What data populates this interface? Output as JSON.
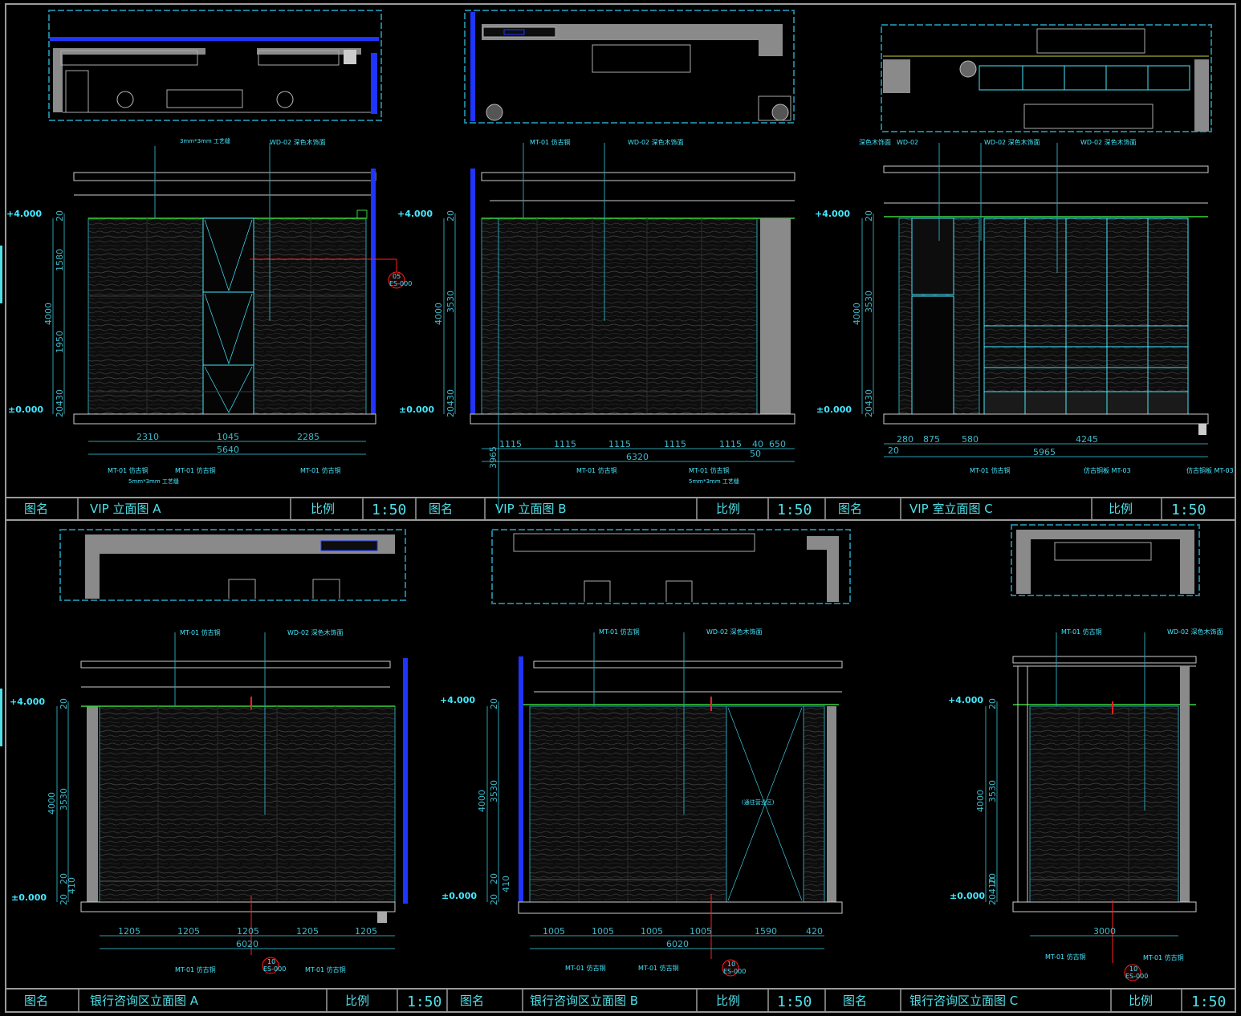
{
  "title_block": {
    "row1": [
      {
        "name_label": "图名",
        "name": "VIP 立面图  A",
        "scale_label": "比例",
        "scale": "1:50"
      },
      {
        "name_label": "图名",
        "name": "VIP 立面图  B",
        "scale_label": "比例",
        "scale": "1:50"
      },
      {
        "name_label": "图名",
        "name": "VIP 室立面图  C",
        "scale_label": "比例",
        "scale": "1:50"
      }
    ],
    "row2": [
      {
        "name_label": "图名",
        "name": "银行咨询区立面图  A",
        "scale_label": "比例",
        "scale": "1:50"
      },
      {
        "name_label": "图名",
        "name": "银行咨询区立面图    B",
        "scale_label": "比例",
        "scale": "1:50"
      },
      {
        "name_label": "图名",
        "name": "银行咨询区立面图    C",
        "scale_label": "比例",
        "scale": "1:50"
      }
    ]
  },
  "levels": {
    "top": "+4.000",
    "bottom": "±0.000"
  },
  "drawings": [
    {
      "id": "vip-a",
      "tags": [
        "3mm*3mm 工艺缝",
        "WD-02  深色木饰面",
        "MT-01  仿古铜",
        "MT-01  仿古铜",
        "MT-01  仿古铜",
        "5mm*3mm 工艺缝"
      ],
      "callout": [
        "05",
        "ES-000"
      ],
      "vdims": [
        "20",
        "1580",
        "4000",
        "1950",
        "20",
        "430"
      ],
      "hdims": [
        "2310",
        "1045",
        "2285"
      ],
      "total": "5640"
    },
    {
      "id": "vip-b",
      "tags": [
        "MT-01  仿古铜",
        "WD-02  深色木饰面",
        "MT-01  仿古铜",
        "MT-01  仿古铜",
        "5mm*3mm 工艺缝"
      ],
      "vdims": [
        "20",
        "3530",
        "4000",
        "20",
        "430"
      ],
      "hdims": [
        "1115",
        "1115",
        "1115",
        "1115",
        "1115",
        "40",
        "650"
      ],
      "total": "6320",
      "extra": [
        "50",
        "3965"
      ]
    },
    {
      "id": "vip-c",
      "tags": [
        "深色木饰面",
        "WD-02",
        "WD-02  深色木饰面",
        "WD-02  深色木饰面",
        "MT-01  仿古铜",
        "仿古铜板  MT-03",
        "仿古铜板  MT-03"
      ],
      "vdims": [
        "20",
        "3530",
        "4000",
        "20",
        "430"
      ],
      "hdims": [
        "280",
        "875",
        "580",
        "4245"
      ],
      "total": "5965",
      "extra": [
        "20"
      ]
    },
    {
      "id": "bank-a",
      "tags": [
        "MT-01  仿古铜",
        "WD-02  深色木饰面",
        "MT-01  仿古铜",
        "MT-01  仿古铜"
      ],
      "callout": [
        "10",
        "ES-000"
      ],
      "vdims": [
        "20",
        "3530",
        "4000",
        "20",
        "410",
        "20"
      ],
      "hdims": [
        "1205",
        "1205",
        "1205",
        "1205",
        "1205"
      ],
      "total": "6020"
    },
    {
      "id": "bank-b",
      "tags": [
        "MT-01  仿古铜",
        "WD-02  深色木饰面",
        "MT-01  仿古铜",
        "MT-01  仿古铜"
      ],
      "callout": [
        "10",
        "ES-000"
      ],
      "note": "(通往营业区)",
      "vdims": [
        "20",
        "3530",
        "4000",
        "20",
        "410",
        "20"
      ],
      "hdims": [
        "1005",
        "1005",
        "1005",
        "1005",
        "1590",
        "420"
      ],
      "total": "6020"
    },
    {
      "id": "bank-c",
      "tags": [
        "MT-01  仿古铜",
        "WD-02  深色木饰面",
        "MT-01  仿古铜",
        "MT-01  仿古铜"
      ],
      "callout": [
        "10",
        "ES-000"
      ],
      "vdims": [
        "20",
        "3530",
        "4000",
        "20",
        "410",
        "20"
      ],
      "hdims": [],
      "total": "3000"
    }
  ],
  "colors": {
    "background": "#000000",
    "frame": "#9a9a9a",
    "cyan": "#3fe0ec",
    "dim_cyan": "#2a9fb0",
    "blue": "#1f35ff",
    "green": "#39d43a",
    "red": "#ff2020",
    "wall_gray": "#8a8a8a",
    "plan_border": "#1b7e93"
  }
}
